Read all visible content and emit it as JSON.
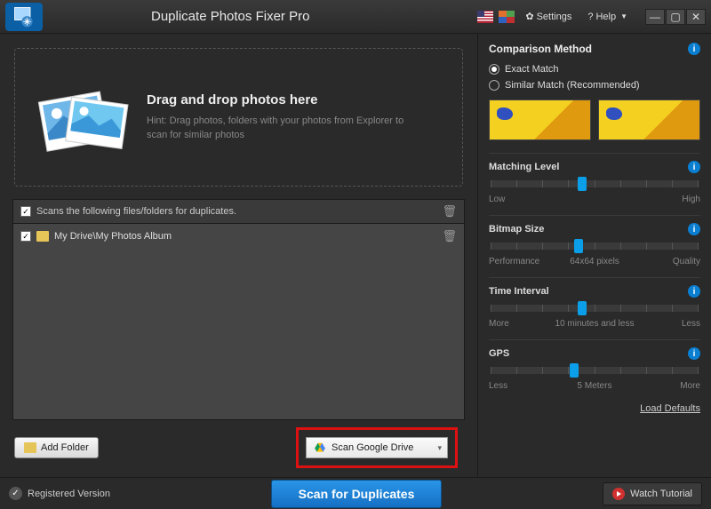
{
  "titlebar": {
    "title": "Duplicate Photos Fixer Pro",
    "settings_label": "Settings",
    "help_label": "Help"
  },
  "drop": {
    "heading": "Drag and drop photos here",
    "hint": "Hint: Drag photos, folders with your photos from Explorer to scan for similar photos"
  },
  "list": {
    "header": "Scans the following files/folders for duplicates.",
    "items": [
      {
        "checked": true,
        "path": "My Drive\\My Photos Album"
      }
    ]
  },
  "left_actions": {
    "add_folder": "Add Folder",
    "scan_google_drive": "Scan Google Drive"
  },
  "panel": {
    "comparison_title": "Comparison Method",
    "exact": "Exact Match",
    "similar": "Similar Match (Recommended)",
    "matching": {
      "title": "Matching Level",
      "low": "Low",
      "high": "High",
      "pos": 42
    },
    "bitmap": {
      "title": "Bitmap Size",
      "perf": "Performance",
      "qual": "Quality",
      "value": "64x64 pixels",
      "pos": 40
    },
    "time": {
      "title": "Time Interval",
      "more": "More",
      "less": "Less",
      "value": "10 minutes and less",
      "pos": 42
    },
    "gps": {
      "title": "GPS",
      "less": "Less",
      "more": "More",
      "value": "5 Meters",
      "pos": 38
    },
    "load_defaults": "Load Defaults"
  },
  "footer": {
    "registered": "Registered Version",
    "scan": "Scan for Duplicates",
    "watch": "Watch Tutorial"
  }
}
